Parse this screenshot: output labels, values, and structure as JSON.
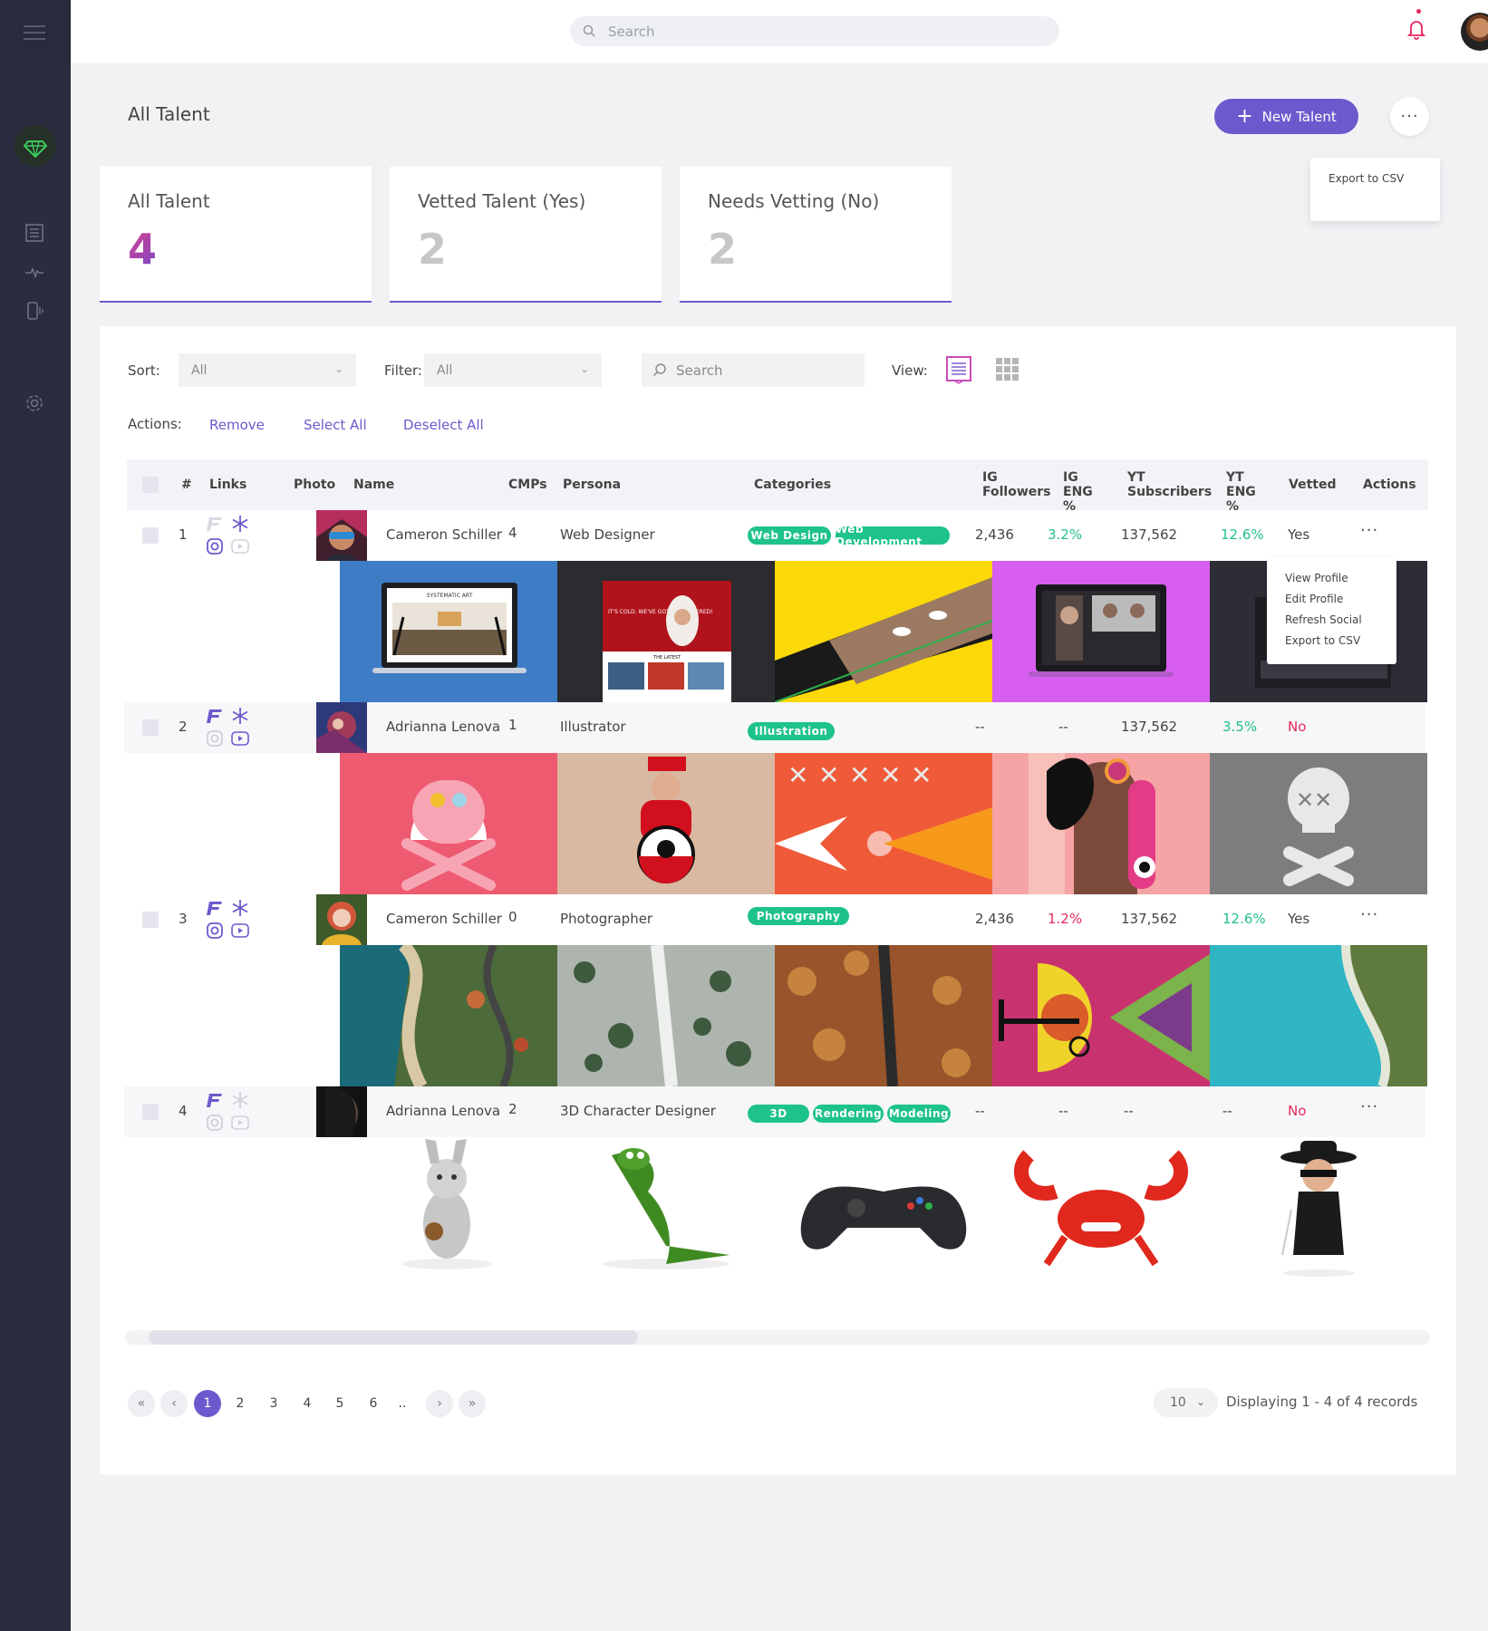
{
  "topbar": {
    "search_placeholder": "Search"
  },
  "page": {
    "title": "All Talent",
    "new_button": "New Talent",
    "more_icon": "···",
    "export_menu": [
      "Export to CSV"
    ]
  },
  "stats": [
    {
      "label": "All Talent",
      "value": "4"
    },
    {
      "label": "Vetted Talent (Yes)",
      "value": "2"
    },
    {
      "label": "Needs Vetting (No)",
      "value": "2"
    }
  ],
  "controls": {
    "sort_label": "Sort:",
    "sort_value": "All",
    "filter_label": "Filter:",
    "filter_value": "All",
    "search_placeholder": "Search",
    "view_label": "View:",
    "actions_label": "Actions:",
    "actions": [
      "Remove",
      "Select All",
      "Deselect All"
    ]
  },
  "table": {
    "headers": {
      "num": "#",
      "links": "Links",
      "photo": "Photo",
      "name": "Name",
      "cmps": "CMPs",
      "persona": "Persona",
      "categories": "Categories",
      "ig_followers": "IG Followers",
      "ig_eng": "IG ENG %",
      "yt_subs": "YT Subscribers",
      "yt_eng": "YT ENG %",
      "vetted": "Vetted",
      "actions": "Actions"
    },
    "rows": [
      {
        "num": "1",
        "name": "Cameron Schiller",
        "cmps": "4",
        "persona": "Web Designer",
        "categories": [
          "Web Design",
          "Web Development"
        ],
        "ig_followers": "2,436",
        "ig_eng": "3.2%",
        "yt_subs": "137,562",
        "yt_eng": "12.6%",
        "vetted": "Yes"
      },
      {
        "num": "2",
        "name": "Adrianna Lenova",
        "cmps": "1",
        "persona": "Illustrator",
        "categories": [
          "Illustration"
        ],
        "ig_followers": "--",
        "ig_eng": "--",
        "yt_subs": "137,562",
        "yt_eng": "3.5%",
        "vetted": "No"
      },
      {
        "num": "3",
        "name": "Cameron Schiller",
        "cmps": "0",
        "persona": "Photographer",
        "categories": [
          "Photography"
        ],
        "ig_followers": "2,436",
        "ig_eng": "1.2%",
        "yt_subs": "137,562",
        "yt_eng": "12.6%",
        "vetted": "Yes"
      },
      {
        "num": "4",
        "name": "Adrianna Lenova",
        "cmps": "2",
        "persona": "3D Character Designer",
        "categories": [
          "3D",
          "Rendering",
          "Modeling"
        ],
        "ig_followers": "--",
        "ig_eng": "--",
        "yt_subs": "--",
        "yt_eng": "--",
        "vetted": "No"
      }
    ],
    "row_menu": [
      "View Profile",
      "Edit Profile",
      "Refresh Social",
      "Export to CSV"
    ]
  },
  "portfolio_text": {
    "site_brand": "SYSTEMATIC ART",
    "site2_headline": "IT'S COLD. WE'VE GOT YOU COVERED!",
    "site2_section": "THE LATEST"
  },
  "pagination": {
    "first": "«",
    "prev": "‹",
    "pages": [
      "1",
      "2",
      "3",
      "4",
      "5",
      "6",
      ".."
    ],
    "next": "›",
    "last": "»",
    "current": "1",
    "per_page": "10",
    "display": "Displaying 1 - 4 of 4 records"
  },
  "colors": {
    "accent": "#6b5acd",
    "tag_green": "#1ec28b",
    "negative": "#e5295b",
    "sidebar": "#2b2c3f"
  }
}
